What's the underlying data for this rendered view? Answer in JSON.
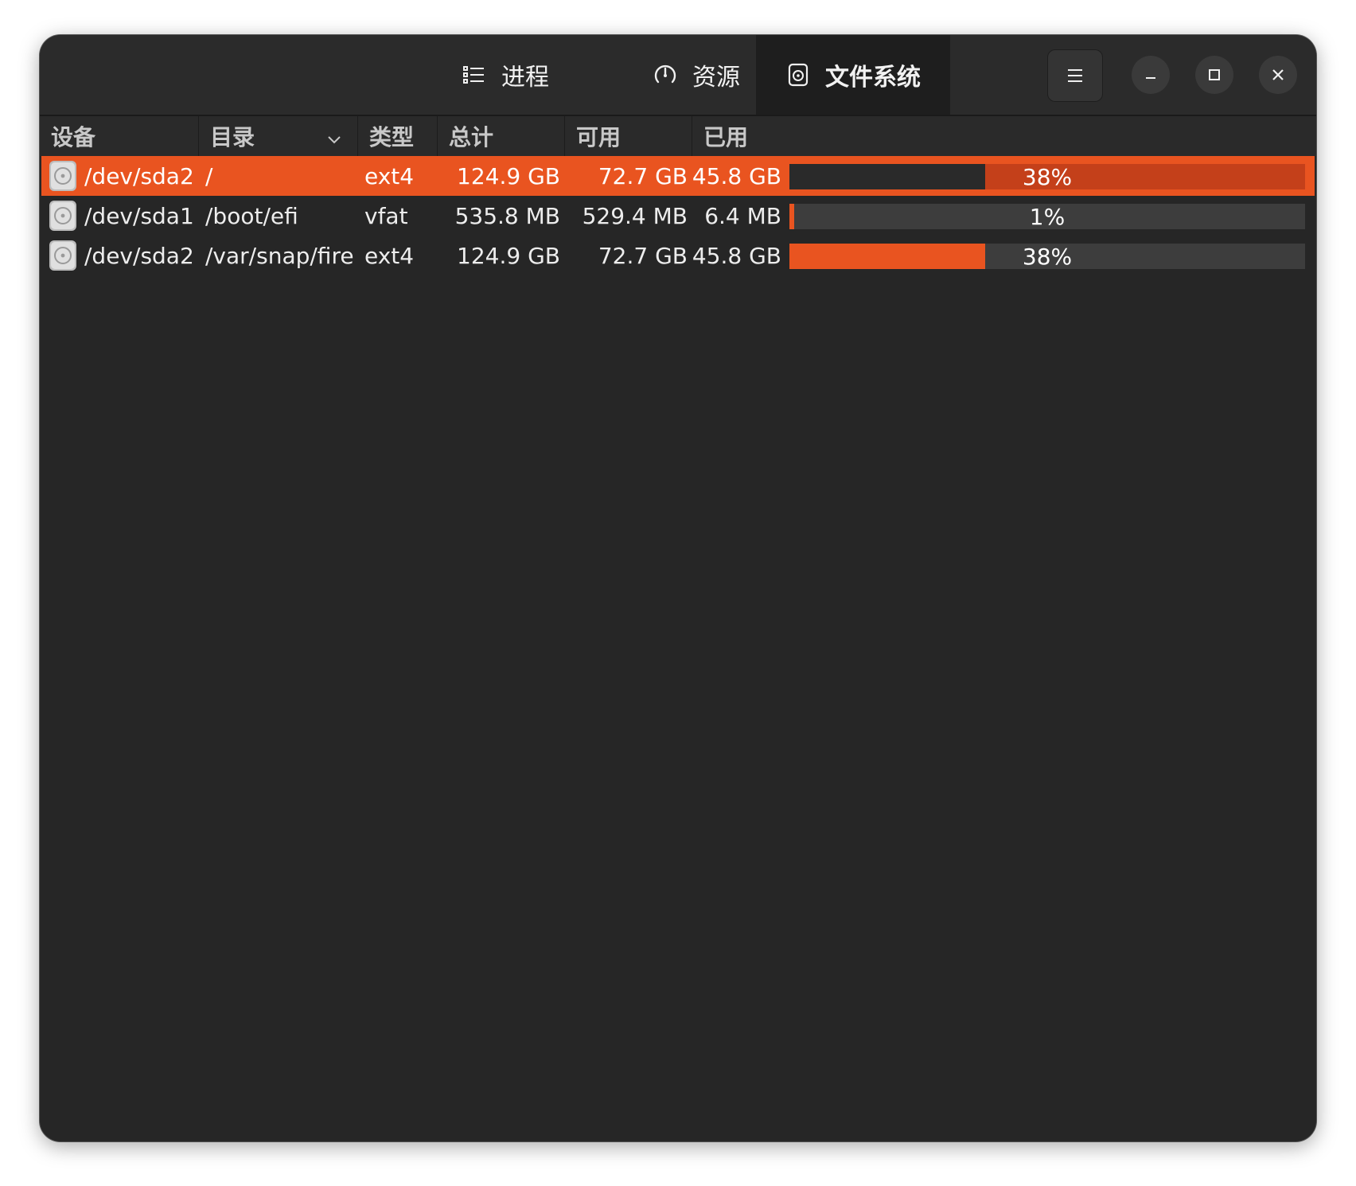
{
  "tabs": [
    {
      "label": "进程",
      "icon": "list-icon",
      "active": false
    },
    {
      "label": "资源",
      "icon": "gauge-icon",
      "active": false
    },
    {
      "label": "文件系统",
      "icon": "disk-icon",
      "active": true
    }
  ],
  "window_controls": {
    "menu": "hamburger-menu-icon",
    "minimize": "minimize-icon",
    "maximize": "maximize-icon",
    "close": "close-icon"
  },
  "columns": {
    "device": "设备",
    "directory": "目录",
    "type": "类型",
    "total": "总计",
    "available": "可用",
    "used": "已用"
  },
  "sort": {
    "column": "directory",
    "direction": "descending"
  },
  "rows": [
    {
      "device": "/dev/sda2",
      "directory": "/",
      "type": "ext4",
      "total": "124.9 GB",
      "available": "72.7 GB",
      "used": "45.8 GB",
      "percent_label": "38%",
      "percent": 38,
      "selected": true
    },
    {
      "device": "/dev/sda1",
      "directory": "/boot/efi",
      "type": "vfat",
      "total": "535.8 MB",
      "available": "529.4 MB",
      "used": "6.4 MB",
      "percent_label": "1%",
      "percent": 1,
      "selected": false
    },
    {
      "device": "/dev/sda2",
      "directory": "/var/snap/firel",
      "type": "ext4",
      "total": "124.9 GB",
      "available": "72.7 GB",
      "used": "45.8 GB",
      "percent_label": "38%",
      "percent": 38,
      "selected": false
    }
  ],
  "colors": {
    "accent": "#e95420",
    "window_bg": "#262626",
    "header_bg": "#2b2b2b",
    "active_tab_bg": "#1e1e1e",
    "bar_track": "#3d3d3d"
  }
}
